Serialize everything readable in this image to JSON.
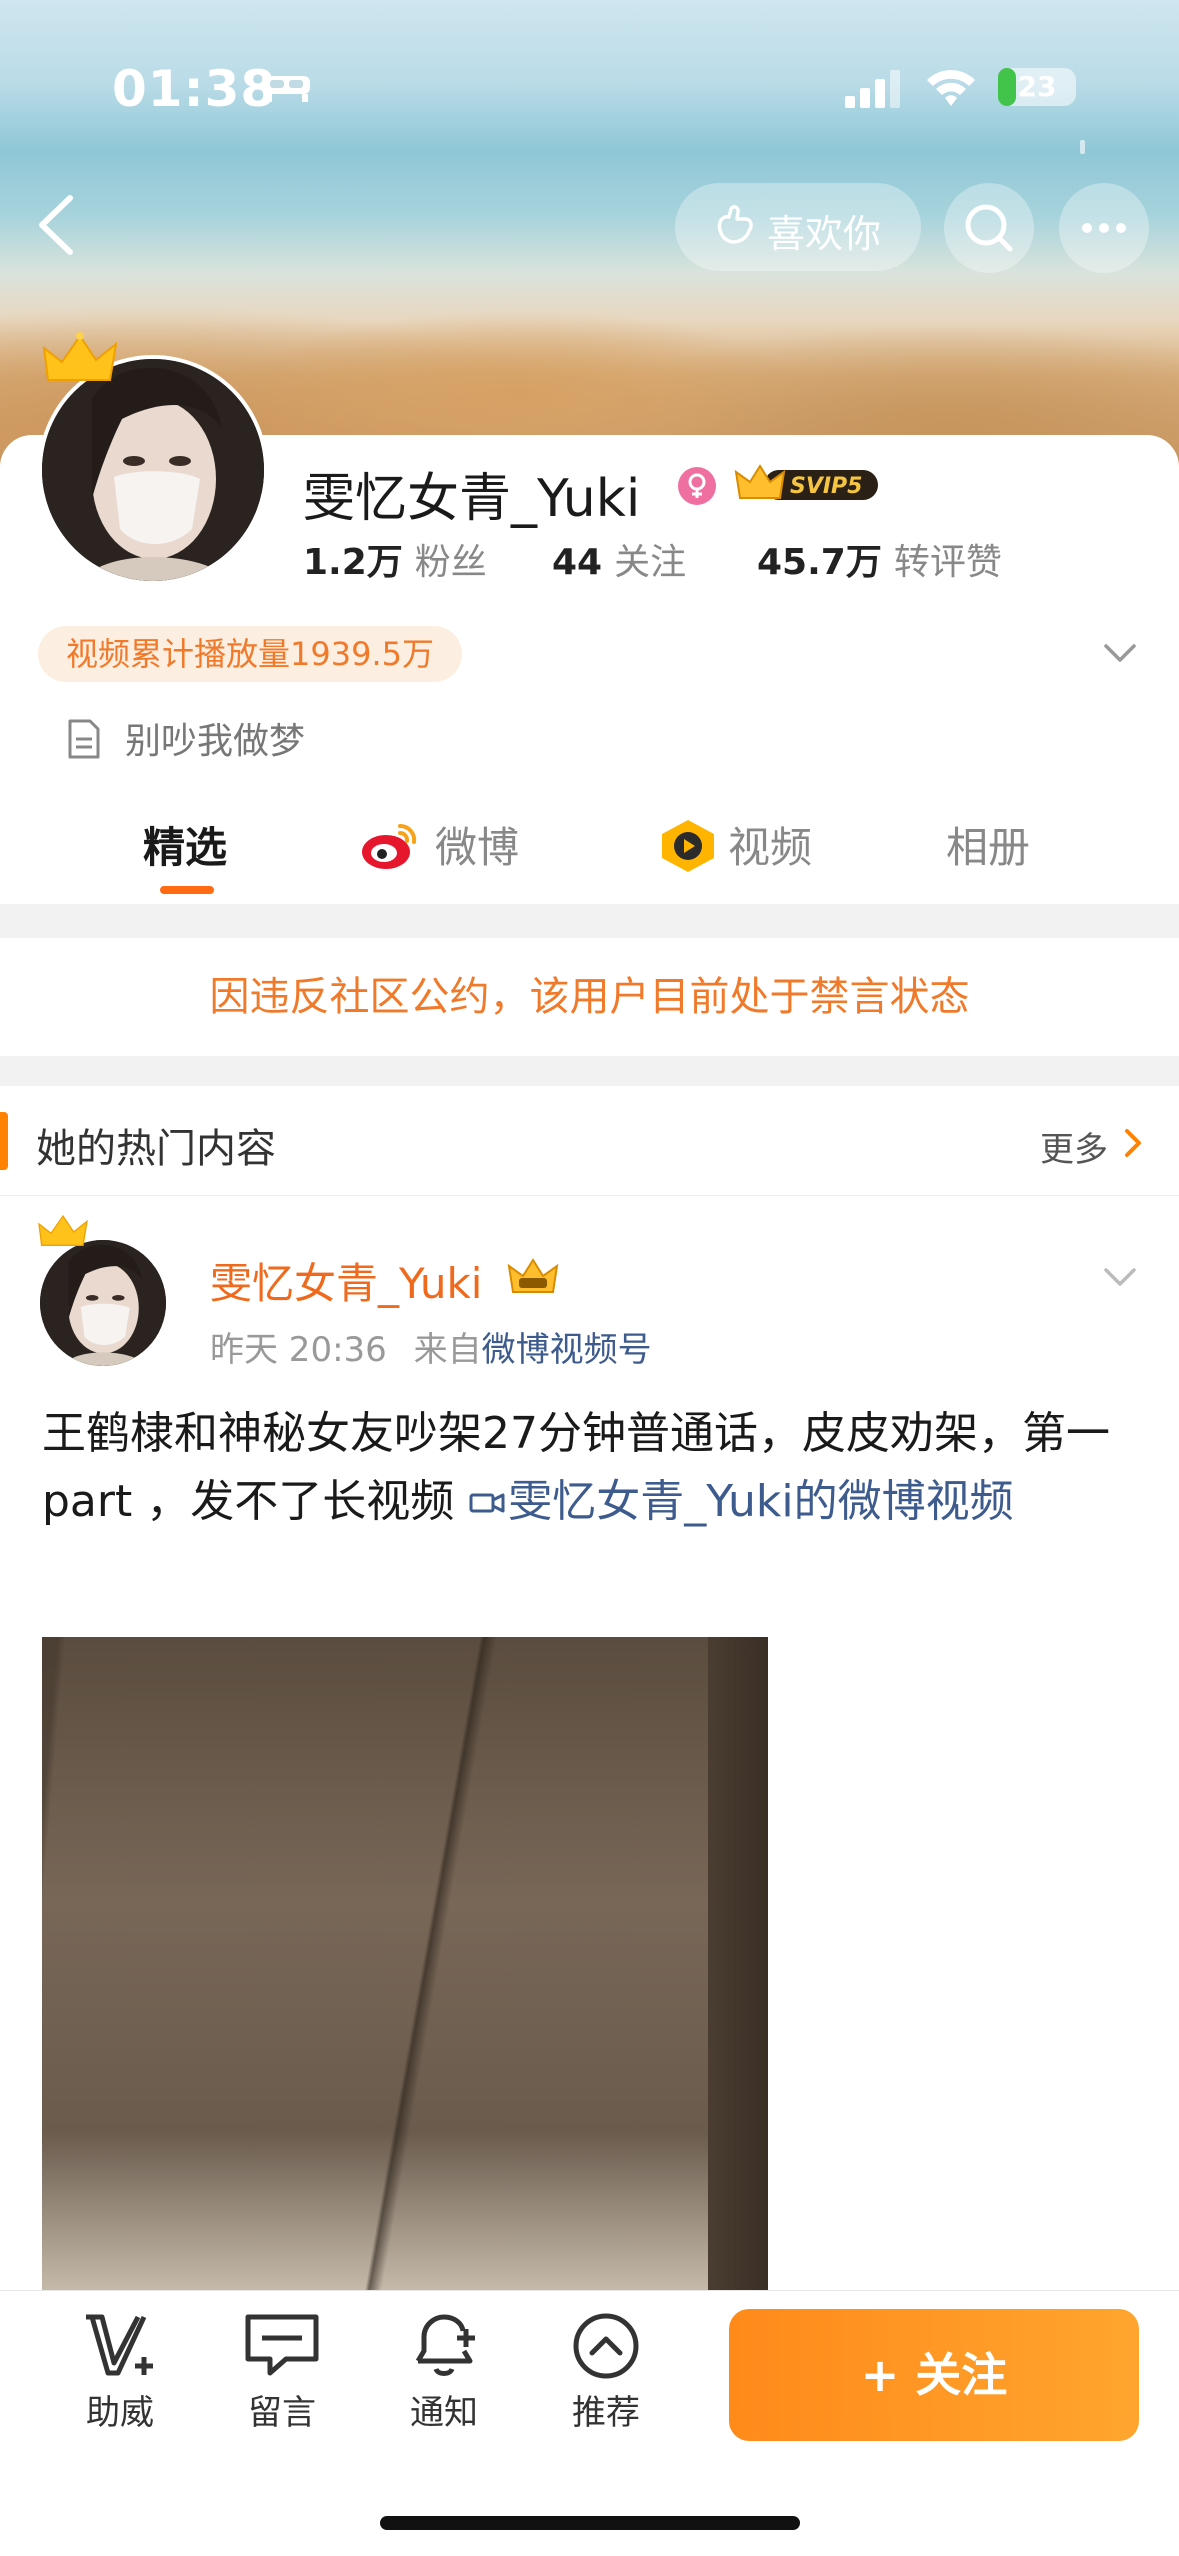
{
  "status_bar": {
    "time": "01:38",
    "battery": "23",
    "battery_level": 0.23
  },
  "header": {
    "like_label": "喜欢你"
  },
  "profile": {
    "name": "雯忆女青_Yuki",
    "vip": "SVIP5",
    "stats": [
      {
        "value": "1.2万",
        "label": "粉丝"
      },
      {
        "value": "44",
        "label": "关注"
      },
      {
        "value": "45.7万",
        "label": "转评赞"
      }
    ],
    "play_count": "视频累计播放量1939.5万",
    "bio": "别吵我做梦"
  },
  "tabs": [
    {
      "label": "精选",
      "active": true
    },
    {
      "label": "微博",
      "active": false
    },
    {
      "label": "视频",
      "active": false
    },
    {
      "label": "相册",
      "active": false
    }
  ],
  "ban_notice": "因违反社区公约，该用户目前处于禁言状态",
  "hot_section": {
    "title": "她的热门内容",
    "more": "更多"
  },
  "post": {
    "author": "雯忆女青_Yuki",
    "time": "昨天 20:36",
    "from": "来自",
    "source": "微博视频号",
    "text": "王鹤棣和神秘女友吵架27分钟普通话，皮皮劝架，第一part ，发不了长视频 ",
    "link": "雯忆女青_Yuki的微博视频"
  },
  "bottom_bar": {
    "tools": [
      "助威",
      "留言",
      "通知",
      "推荐"
    ],
    "follow": "+ 关注"
  },
  "colors": {
    "accent": "#ff8200",
    "link": "#3d5b8d",
    "ban": "#f07a2a"
  }
}
